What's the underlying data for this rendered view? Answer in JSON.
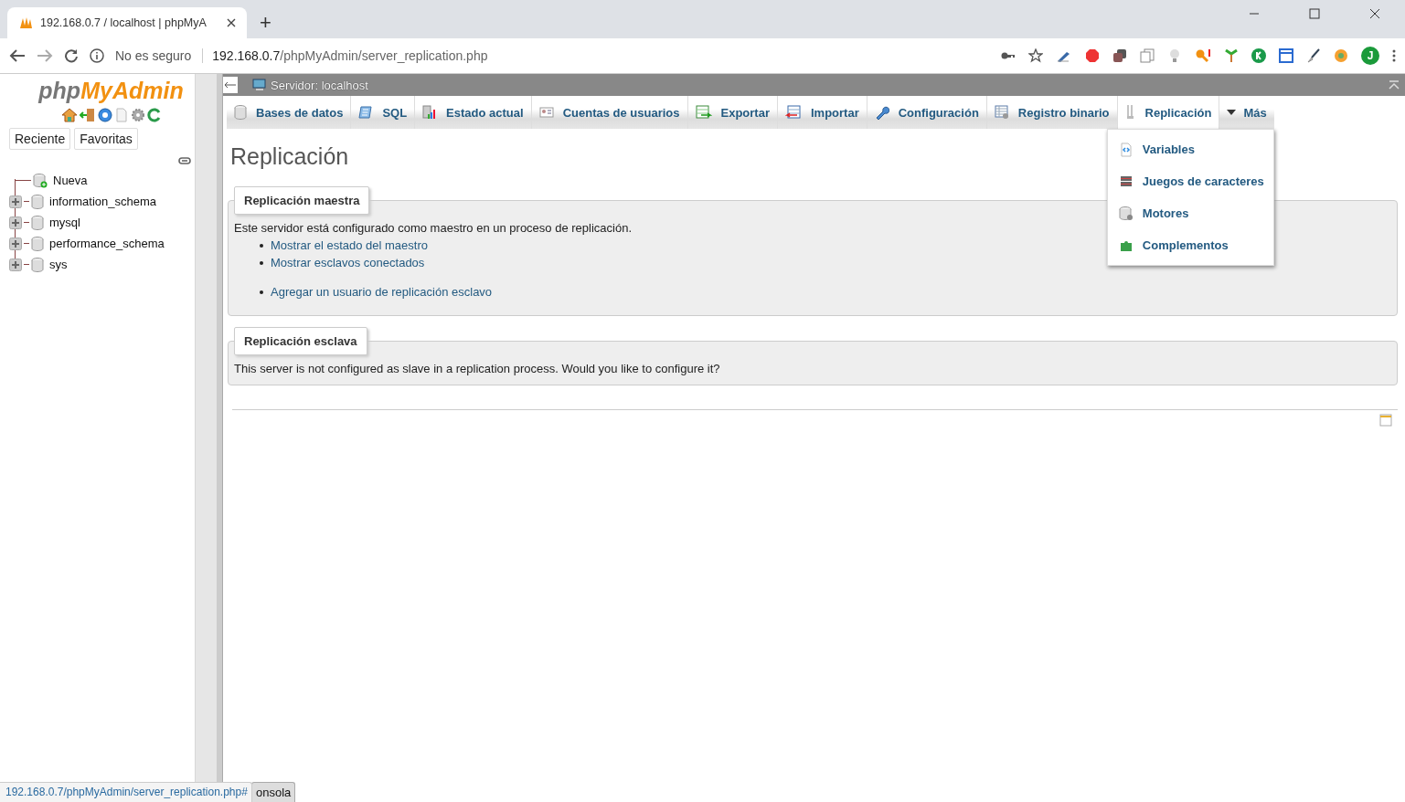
{
  "browser": {
    "tab_title": "192.168.0.7 / localhost | phpMyA",
    "new_tab": "+",
    "security": "No es seguro",
    "url_host": "192.168.0.7",
    "url_path": "/phpMyAdmin/server_replication.php",
    "profile_initial": "J"
  },
  "sidebar": {
    "logo_part_1": "php",
    "logo_part_2": "MyAdmin",
    "buttons": [
      "Reciente",
      "Favoritas"
    ],
    "tree": [
      {
        "label": "Nueva",
        "kind": "new"
      },
      {
        "label": "information_schema",
        "kind": "db"
      },
      {
        "label": "mysql",
        "kind": "db"
      },
      {
        "label": "performance_schema",
        "kind": "db"
      },
      {
        "label": "sys",
        "kind": "db"
      }
    ]
  },
  "main": {
    "server_title": "Servidor: localhost",
    "tabs": [
      {
        "label": "Bases de datos",
        "selected": false
      },
      {
        "label": "SQL",
        "selected": false
      },
      {
        "label": "Estado actual",
        "selected": false
      },
      {
        "label": "Cuentas de usuarios",
        "selected": false
      },
      {
        "label": "Exportar",
        "selected": false
      },
      {
        "label": "Importar",
        "selected": false
      },
      {
        "label": "Configuración",
        "selected": false
      },
      {
        "label": "Registro binario",
        "selected": false
      },
      {
        "label": "Replicación",
        "selected": true
      }
    ],
    "more": {
      "label": "Más",
      "expanded": true,
      "items": [
        "Variables",
        "Juegos de caracteres",
        "Motores",
        "Complementos"
      ]
    },
    "heading": "Replicación",
    "sections": [
      {
        "legend": "Replicación maestra",
        "text": "Este servidor está configurado como maestro en un proceso de replicación.",
        "links": [
          "Mostrar el estado del maestro",
          "Mostrar esclavos conectados"
        ],
        "extra_links": [
          "Agregar un usuario de replicación esclavo"
        ]
      },
      {
        "legend": "Replicación esclava",
        "text": "This server is not configured as slave in a replication process. Would you like to configure it?"
      }
    ],
    "console": "onsola"
  },
  "status_url": "192.168.0.7/phpMyAdmin/server_replication.php#"
}
